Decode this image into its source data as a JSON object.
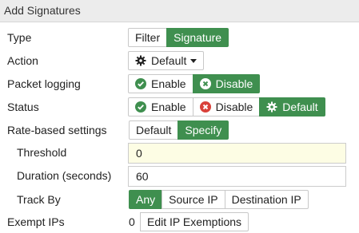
{
  "header": {
    "title": "Add Signatures"
  },
  "type": {
    "label": "Type",
    "options": [
      "Filter",
      "Signature"
    ],
    "selected": "Signature"
  },
  "action": {
    "label": "Action",
    "value": "Default",
    "icon": "gear-icon"
  },
  "packet_logging": {
    "label": "Packet logging",
    "enable": "Enable",
    "disable": "Disable",
    "selected": "Disable"
  },
  "status": {
    "label": "Status",
    "enable": "Enable",
    "disable": "Disable",
    "default": "Default",
    "selected": "Default"
  },
  "rate_based": {
    "label": "Rate-based settings",
    "options": [
      "Default",
      "Specify"
    ],
    "selected": "Specify"
  },
  "threshold": {
    "label": "Threshold",
    "value": "0"
  },
  "duration": {
    "label": "Duration (seconds)",
    "value": "60"
  },
  "track_by": {
    "label": "Track By",
    "options": [
      "Any",
      "Source IP",
      "Destination IP"
    ],
    "selected": "Any"
  },
  "exempt_ips": {
    "label": "Exempt IPs",
    "count": "0",
    "button": "Edit IP Exemptions"
  },
  "colors": {
    "active_green": "#3f8f4f",
    "enable_green": "#3f8f4f",
    "disable_red": "#d9413a",
    "threshold_bg": "#fdfde4"
  }
}
